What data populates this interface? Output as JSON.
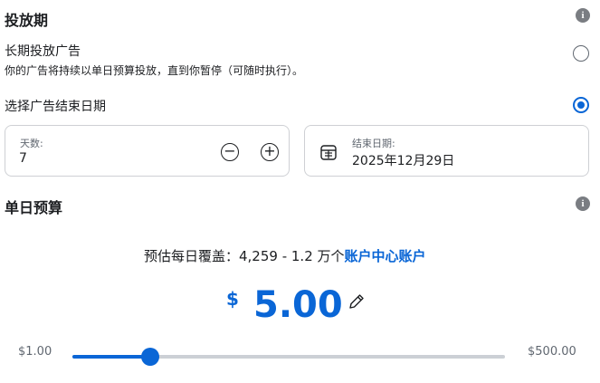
{
  "schedule": {
    "title": "投放期",
    "long_term": {
      "title": "长期投放广告",
      "description": "你的广告将持续以单日预算投放，直到你暂停（可随时执行）。"
    },
    "end_date_option": {
      "title": "选择广告结束日期"
    },
    "days_field": {
      "label": "天数:",
      "value": "7"
    },
    "end_date_field": {
      "label": "结束日期:",
      "value": "2025年12月29日"
    }
  },
  "budget": {
    "title": "单日预算",
    "reach_prefix": "预估每日覆盖：4,259 - 1.2 万个",
    "reach_link": "账户中心账户",
    "currency_symbol": "$",
    "amount": "5.00",
    "slider": {
      "min_label": "$1.00",
      "max_label": "$500.00",
      "fill_percent": 18
    }
  },
  "colors": {
    "accent": "#0a66d6",
    "track": "#ccd0d5"
  },
  "icons": [
    "info-icon",
    "minus-icon",
    "plus-icon",
    "calendar-icon",
    "pencil-icon"
  ]
}
